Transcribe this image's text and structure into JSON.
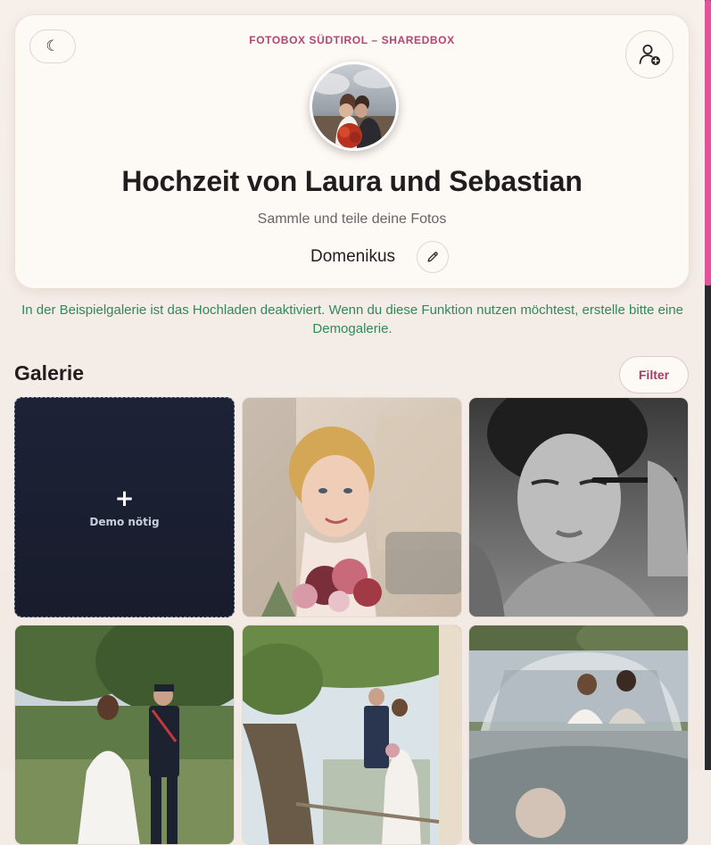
{
  "header": {
    "brand": "FOTOBOX SÜDTIROL – SHAREDBOX",
    "title": "Hochzeit von Laura und Sebastian",
    "subtitle": "Sammle und teile deine Fotos",
    "guest_name": "Domenikus",
    "theme_icon": "moon-icon",
    "add_user_icon": "user-plus-icon",
    "edit_icon": "pencil-icon"
  },
  "notice": "In der Beispielgalerie ist das Hochladen deaktiviert. Wenn du diese Funktion nutzen möchtest, erstelle bitte eine Demogalerie.",
  "gallery": {
    "heading": "Galerie",
    "filter_label": "Filter",
    "upload_tile": {
      "plus": "+",
      "label": "Demo nötig"
    },
    "photos": [
      "bride-portrait-with-bouquet",
      "bride-black-white-mascara",
      "couple-walking-in-park",
      "couple-under-tree",
      "couple-kissing-in-vintage-car"
    ]
  },
  "colors": {
    "accent": "#b2466e",
    "notice": "#2f8a5a",
    "background": "#f3ebe6",
    "card": "#fdf9f5",
    "upload_tile": "#1d2236"
  }
}
